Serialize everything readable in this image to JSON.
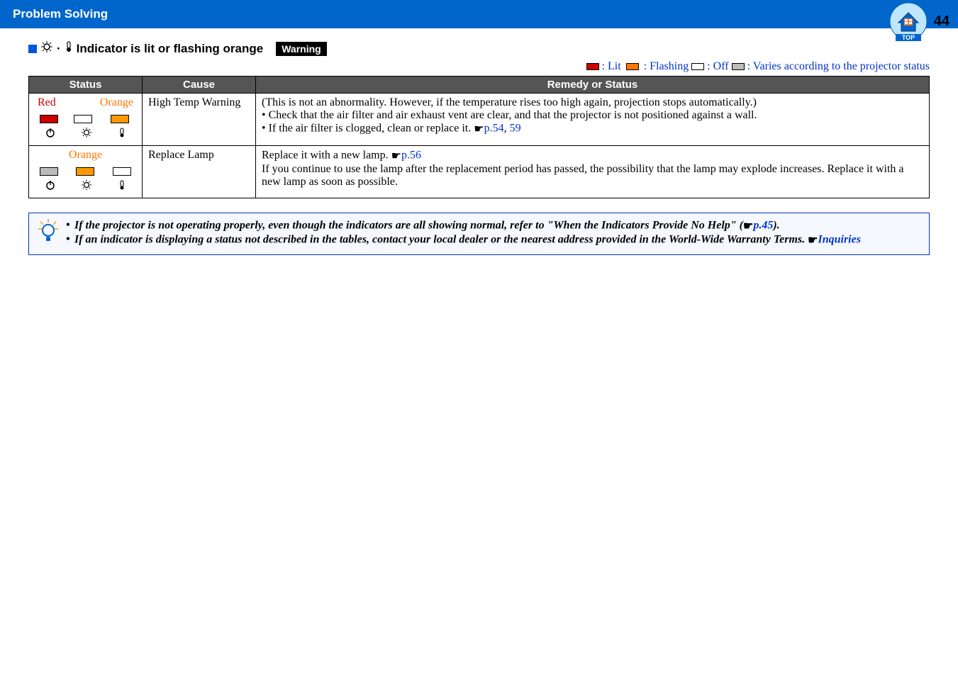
{
  "header": {
    "title": "Problem Solving",
    "page_number": "44",
    "top_label": "TOP"
  },
  "section": {
    "title_text": "Indicator is lit or flashing orange",
    "warning_badge": "Warning"
  },
  "legend": {
    "lit": ": Lit ",
    "flashing": ": Flashing ",
    "off": ": Off ",
    "varies": ": Varies according to the projector status"
  },
  "table": {
    "headers": {
      "status": "Status",
      "cause": "Cause",
      "remedy": "Remedy or Status"
    },
    "rows": [
      {
        "status_labels": {
          "left": "Red",
          "right": "Orange"
        },
        "cause": "High Temp Warning",
        "remedy_main": "(This is not an abnormality. However, if the temperature rises too high again, projection stops automatically.)",
        "remedy_b1": "Check that the air filter and air exhaust vent are clear, and that the projector is not positioned against a wall.",
        "remedy_b2_pre": "If the air filter is clogged, clean or replace it. ",
        "remedy_b2_link1": "p.54",
        "remedy_b2_sep": ", ",
        "remedy_b2_link2": "59"
      },
      {
        "status_labels": {
          "center": "Orange"
        },
        "cause": "Replace Lamp",
        "remedy_line1_pre": "Replace it with a new lamp. ",
        "remedy_line1_link": "p.56",
        "remedy_line2": "If you continue to use the lamp after the replacement period has passed, the possibility that the lamp may explode increases. Replace it with a new lamp as soon as possible."
      }
    ]
  },
  "tip": {
    "b1_pre": "If the projector is not operating properly, even though the indicators are all showing normal, refer to \"When the Indicators Provide No Help\" (",
    "b1_link": "p.45",
    "b1_post": ").",
    "b2_pre": "If an indicator is displaying a status not described in the tables, contact your local dealer or the nearest address provided in the World-Wide Warranty Terms. ",
    "b2_link": "Inquiries"
  }
}
